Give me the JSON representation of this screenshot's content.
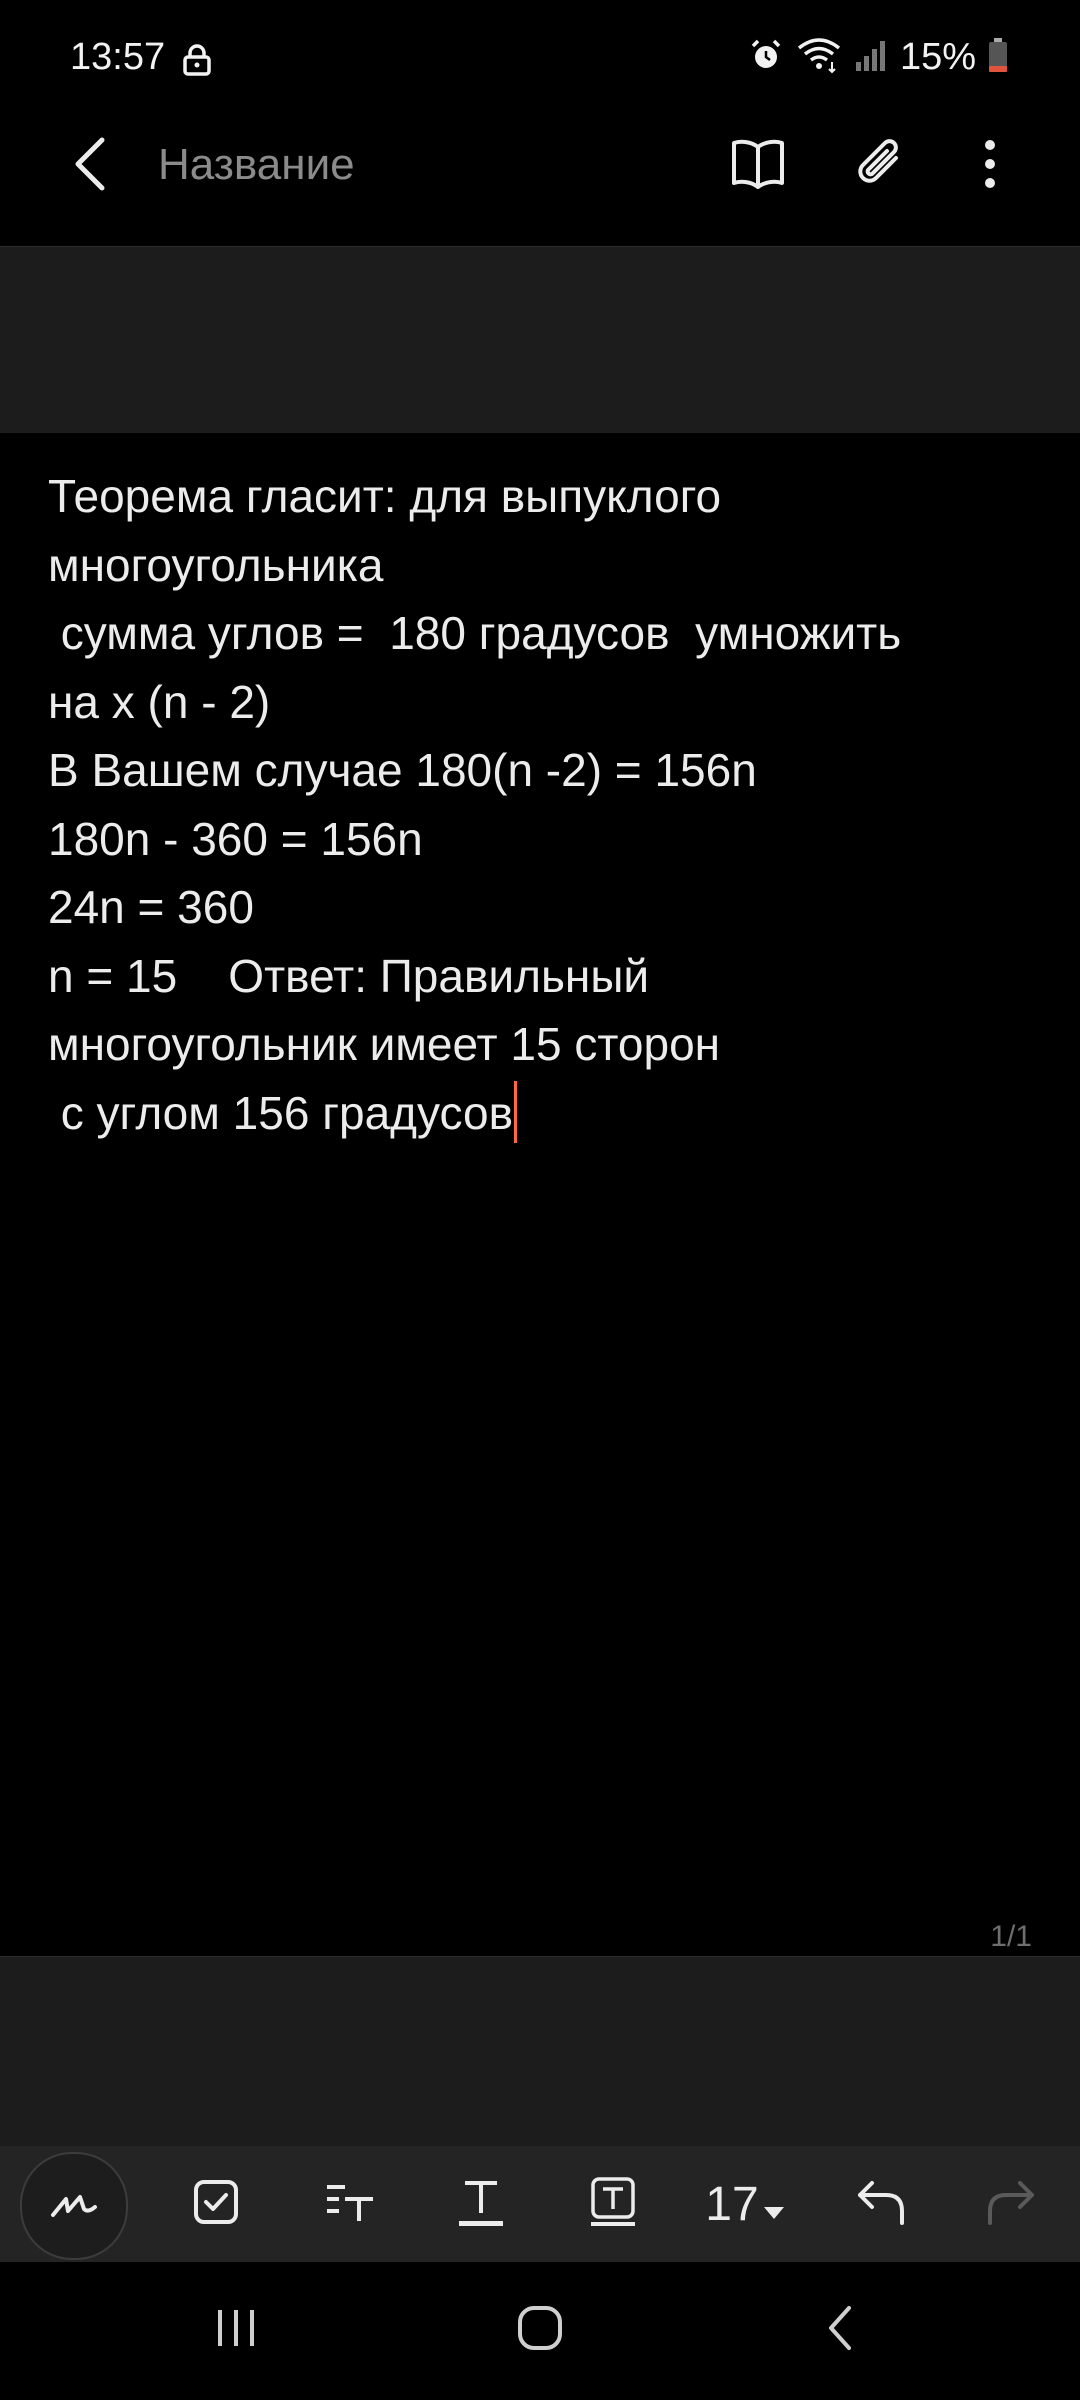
{
  "status": {
    "time": "13:57",
    "battery": "15%"
  },
  "header": {
    "title": "Название"
  },
  "note": {
    "lines": [
      "Теорема гласит: для выпуклого",
      "многоугольника",
      " сумма углов =  180 градусов  умножить",
      "на x (n - 2)",
      "В Вашем случае 180(n -2) = 156n",
      "180n - 360 = 156n",
      "24n = 360",
      "n = 15    Ответ: Правильный",
      "многоугольник имеет 15 сторон",
      " с углом 156 градусов"
    ]
  },
  "page_indicator": "1/1",
  "toolbar": {
    "font_size": "17"
  },
  "icons": {
    "lock": "lock-icon",
    "alarm": "alarm-icon",
    "wifi": "wifi-icon",
    "signal": "signal-icon",
    "battery": "battery-icon",
    "back": "back-arrow-icon",
    "reading": "book-icon",
    "attach": "paperclip-icon",
    "more": "more-vert-icon",
    "pen": "pen-icon",
    "checkbox": "checkbox-icon",
    "text_style": "text-style-icon",
    "text_color": "text-color-icon",
    "text_bg": "text-background-icon",
    "dropdown": "dropdown-arrow-icon",
    "undo": "undo-icon",
    "redo": "redo-icon",
    "recents": "recents-icon",
    "home": "home-icon",
    "nav_back": "nav-back-icon"
  },
  "colors": {
    "caret": "#ff6a3d",
    "battery_low": "#e0533d",
    "panel": "#1c1c1c",
    "toolbar": "#242424"
  }
}
